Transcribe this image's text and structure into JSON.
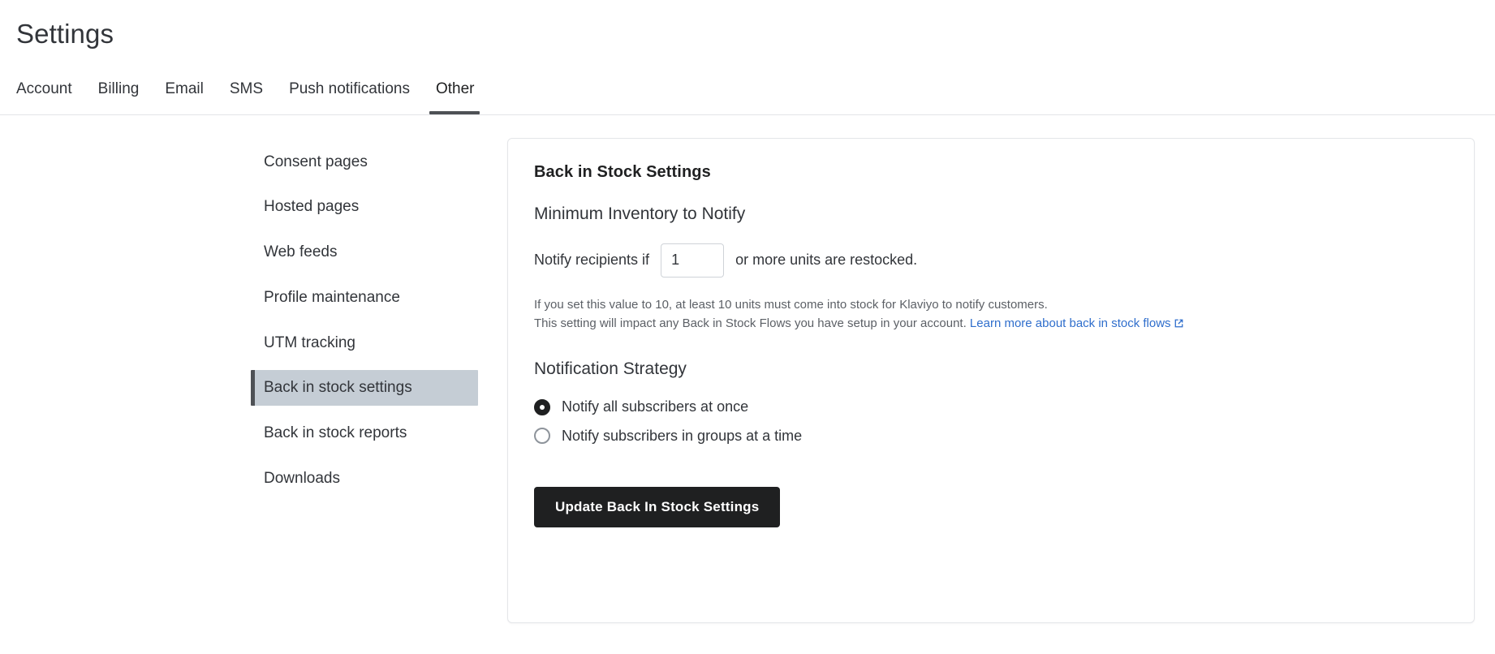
{
  "header": {
    "title": "Settings"
  },
  "tabs": [
    {
      "label": "Account",
      "active": false
    },
    {
      "label": "Billing",
      "active": false
    },
    {
      "label": "Email",
      "active": false
    },
    {
      "label": "SMS",
      "active": false
    },
    {
      "label": "Push notifications",
      "active": false
    },
    {
      "label": "Other",
      "active": true
    }
  ],
  "sidebar": {
    "items": [
      {
        "label": "Consent pages",
        "selected": false
      },
      {
        "label": "Hosted pages",
        "selected": false
      },
      {
        "label": "Web feeds",
        "selected": false
      },
      {
        "label": "Profile maintenance",
        "selected": false
      },
      {
        "label": "UTM tracking",
        "selected": false
      },
      {
        "label": "Back in stock settings",
        "selected": true
      },
      {
        "label": "Back in stock reports",
        "selected": false
      },
      {
        "label": "Downloads",
        "selected": false
      }
    ]
  },
  "card": {
    "title": "Back in Stock Settings",
    "min_inventory": {
      "section_title": "Minimum Inventory to Notify",
      "prefix_text": "Notify recipients if",
      "input_value": "1",
      "input_placeholder": "1",
      "suffix_text": "or more units are restocked.",
      "helper_line_1": "If you set this value to 10, at least 10 units must come into stock for Klaviyo to notify customers.",
      "helper_line_2": "This setting will impact any Back in Stock Flows you have setup in your account.",
      "helper_link_text": "Learn more about back in stock flows"
    },
    "notification_strategy": {
      "section_title": "Notification Strategy",
      "options": [
        {
          "label": "Notify all subscribers at once",
          "checked": true
        },
        {
          "label": "Notify subscribers in groups at a time",
          "checked": false
        }
      ]
    },
    "submit_label": "Update Back In Stock Settings"
  },
  "colors": {
    "accent_link": "#2f6ecc",
    "primary_button": "#1f2021",
    "selected_nav_bg": "#c5cdd5",
    "selected_nav_bar": "#4e5155"
  }
}
